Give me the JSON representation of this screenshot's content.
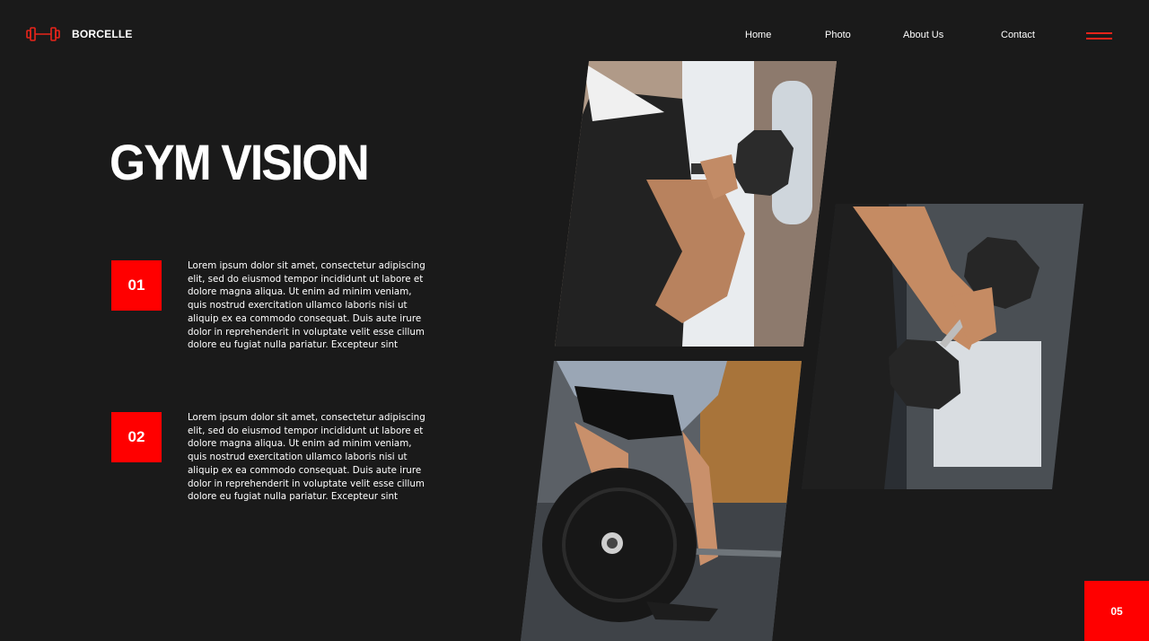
{
  "brand": {
    "name": "BORCELLE",
    "logo_icon": "dumbbell-icon",
    "accent": "#e8241a"
  },
  "nav": {
    "items": [
      "Home",
      "Photo",
      "About Us",
      "Contact"
    ],
    "menu_icon": "hamburger-menu-icon"
  },
  "hero": {
    "title": "GYM VISION"
  },
  "features": [
    {
      "number": "01",
      "text": "Lorem ipsum dolor sit amet, consectetur adipiscing elit, sed do eiusmod tempor incididunt ut labore et dolore magna aliqua. Ut enim ad minim veniam, quis nostrud exercitation ullamco laboris nisi ut aliquip ex ea commodo consequat. Duis aute irure dolor in reprehenderit in voluptate velit esse cillum dolore eu fugiat nulla pariatur. Excepteur sint"
    },
    {
      "number": "02",
      "text": "Lorem ipsum dolor sit amet, consectetur adipiscing elit, sed do eiusmod tempor incididunt ut labore et dolore magna aliqua. Ut enim ad minim veniam, quis nostrud exercitation ullamco laboris nisi ut aliquip ex ea commodo consequat. Duis aute irure dolor in reprehenderit in voluptate velit esse cillum dolore eu fugiat nulla pariatur. Excepteur sint"
    }
  ],
  "page": {
    "number": "05"
  },
  "colors": {
    "background": "#1a1a1a",
    "accent_red": "#ff0000"
  }
}
